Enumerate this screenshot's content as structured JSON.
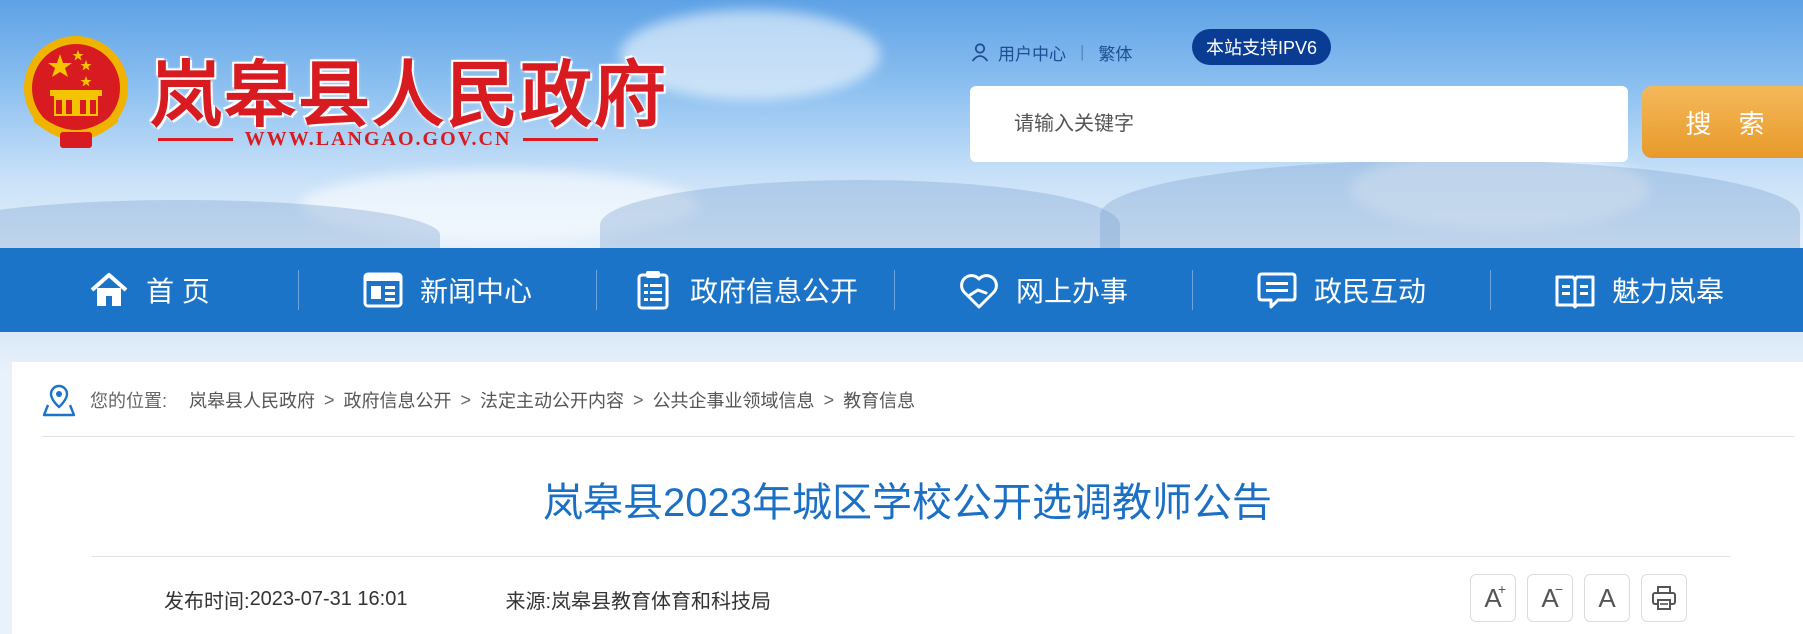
{
  "header": {
    "site_name": "岚皋县人民政府",
    "site_url": "WWW.LANGAO.GOV.CN",
    "emblem_icon": "national-emblem-icon"
  },
  "toplinks": {
    "user_center": "用户中心",
    "traditional": "繁体",
    "ipv6_badge": "本站支持IPV6"
  },
  "search": {
    "placeholder": "请输入关键字",
    "button_label": "搜 索"
  },
  "nav": {
    "items": [
      {
        "label": "首 页",
        "icon": "home-icon"
      },
      {
        "label": "新闻中心",
        "icon": "newspaper-icon"
      },
      {
        "label": "政府信息公开",
        "icon": "clipboard-icon"
      },
      {
        "label": "网上办事",
        "icon": "heart-hand-icon"
      },
      {
        "label": "政民互动",
        "icon": "chat-icon"
      },
      {
        "label": "魅力岚皋",
        "icon": "book-icon"
      }
    ]
  },
  "breadcrumb": {
    "prefix": "您的位置:",
    "items": [
      "岚皋县人民政府",
      "政府信息公开",
      "法定主动公开内容",
      "公共企事业领域信息",
      "教育信息"
    ],
    "separator": ">"
  },
  "article": {
    "title": "岚皋县2023年城区学校公开选调教师公告",
    "publish_label": "发布时间:",
    "publish_time": "2023-07-31 16:01",
    "source_label": "来源:",
    "source": "岚皋县教育体育和科技局"
  },
  "tools": {
    "font_large": "A",
    "font_medium": "A",
    "font_small": "A",
    "print_icon": "print-icon"
  },
  "colors": {
    "nav_blue": "#1b74c8",
    "title_blue": "#1b6fc4",
    "brand_red": "#d71b20",
    "search_orange": "#e79a2a",
    "ipv6_navy": "#0b3c93"
  }
}
